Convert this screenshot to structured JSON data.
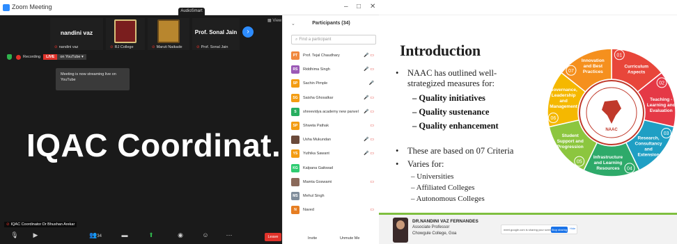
{
  "zoom": {
    "window_title": "Zoom Meeting",
    "audio_label": "AudioSmart",
    "window_controls": [
      "–",
      "□",
      "✕"
    ],
    "view_label": "View",
    "tiles": [
      {
        "name": "nandini vaz",
        "sub": "nandini vaz"
      },
      {
        "name": "",
        "sub": "RJ College"
      },
      {
        "name": "",
        "sub": "Maruti Naikade"
      },
      {
        "name": "Prof. Sonal Jain",
        "sub": "Prof. Sonal Jain"
      }
    ],
    "recording_label": "Recording",
    "live_label": "LIVE",
    "live_on_label": "on YouTube ▾",
    "toast_text": "Meeting is now streaming live on YouTube",
    "main_title": "IQAC Coordinat...",
    "speaker_label": "IQAC Coordinator Dr Bhushan Arekar",
    "toolbar": {
      "participants_count": "34",
      "leave_label": "Leave"
    }
  },
  "participants": {
    "title": "Participants (34)",
    "search_placeholder": "Find a participant",
    "list": [
      {
        "initials": "PT",
        "name": "Prof. Tejal Chaudhary",
        "color": "#f0883e",
        "icons": "🎤 ▭"
      },
      {
        "initials": "RS",
        "name": "Riddhima Singh",
        "color": "#9b59b6",
        "icons": "🎤 ▭"
      },
      {
        "initials": "SP",
        "name": "Sachin Pimple",
        "color": "#f39c12",
        "icons": "🎤"
      },
      {
        "initials": "SG",
        "name": "Saisha Ghosalkar",
        "color": "#f39c12",
        "icons": "🎤 ▭"
      },
      {
        "initials": "S",
        "name": "shreevidya academy new panvel",
        "color": "#27ae60",
        "icons": "🎤 ▭"
      },
      {
        "initials": "SP",
        "name": "Shweta Pathak",
        "color": "#f39c12",
        "icons": "▭"
      },
      {
        "initials": "",
        "name": "Usha Mukundan",
        "color": "#6b4a3a",
        "icons": "🎤 ▭"
      },
      {
        "initials": "YS",
        "name": "Yuthika Sawant",
        "color": "#f39c12",
        "icons": "🎤 ▭"
      },
      {
        "initials": "KG",
        "name": "Kalpana Gaikwad",
        "color": "#2ecc71",
        "icons": ""
      },
      {
        "initials": "",
        "name": "Mamta Goswami",
        "color": "#8a6a5a",
        "icons": "▭"
      },
      {
        "initials": "MS",
        "name": "Mehul Singh",
        "color": "#7f8c9a",
        "icons": ""
      },
      {
        "initials": "N",
        "name": "Naved",
        "color": "#e67e22",
        "icons": "▭"
      }
    ],
    "invite_label": "Invite",
    "unmute_label": "Unmute Me"
  },
  "slide": {
    "title": "Introduction",
    "bullet1_line1": "NAAC has outlined well-",
    "bullet1_line2": "strategized measures for:",
    "sub1": "Quality initiatives",
    "sub2": "Quality sustenance",
    "sub3": "Quality enhancement",
    "bullet2": "These are based on 07 Criteria",
    "bullet3": "Varies for:",
    "sub4": "Universities",
    "sub5": "Affiliated Colleges",
    "sub6": "Autonomous Colleges",
    "wheel": {
      "segments": [
        {
          "num": "01",
          "label": [
            "Curriculum",
            "Aspects"
          ],
          "color": "#e8463a"
        },
        {
          "num": "02",
          "label": [
            "Teaching -",
            "Learning and",
            "Evaluation"
          ],
          "color": "#e53946"
        },
        {
          "num": "03",
          "label": [
            "Research,",
            "Consultancy",
            "and",
            "Extension"
          ],
          "color": "#1f9fc4"
        },
        {
          "num": "04",
          "label": [
            "Infrastructure",
            "and Learning",
            "Resources"
          ],
          "color": "#2eaa6a"
        },
        {
          "num": "05",
          "label": [
            "Student",
            "Support and",
            "Progression"
          ],
          "color": "#8cc63f"
        },
        {
          "num": "06",
          "label": [
            "Governance,",
            "Leadership",
            "and",
            "Management"
          ],
          "color": "#f5b800"
        },
        {
          "num": "07",
          "label": [
            "Innovation",
            "and Best",
            "Practices"
          ],
          "color": "#f5901e"
        }
      ],
      "center_label": "NAAC"
    },
    "presenter_name": "DR.NANDINI VAZ FERNANDES",
    "presenter_role": "Associate Professor",
    "presenter_college": "Chowgule College, Goa",
    "share_text": "meet.google.com is sharing your screen.",
    "stop_share": "Stop sharing",
    "hide_share": "Hide"
  }
}
